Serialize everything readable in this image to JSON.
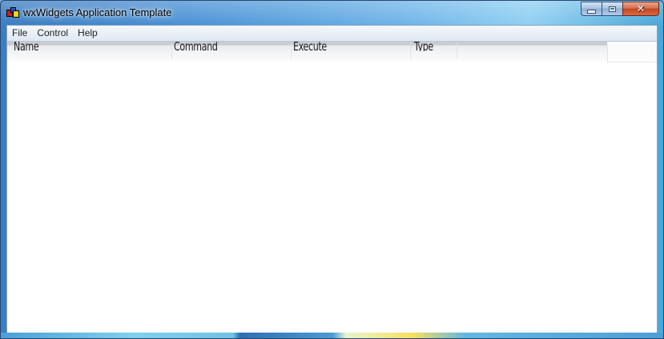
{
  "window": {
    "title": "wxWidgets Application Template",
    "icon": "wxwidgets-app-icon",
    "controls": {
      "minimize_icon": "minimize-icon",
      "maximize_icon": "maximize-icon",
      "close_glyph": "✕"
    }
  },
  "menubar": {
    "items": [
      {
        "label": "File"
      },
      {
        "label": "Control"
      },
      {
        "label": "Help"
      }
    ]
  },
  "list": {
    "columns": [
      {
        "label": "Name"
      },
      {
        "label": "Command"
      },
      {
        "label": "Execute"
      },
      {
        "label": "Type"
      }
    ],
    "rows": []
  },
  "colors": {
    "titlebar": "#4d93d6",
    "close_button": "#c4441f",
    "menubar": "#dfe8f4",
    "client": "#ffffff"
  }
}
